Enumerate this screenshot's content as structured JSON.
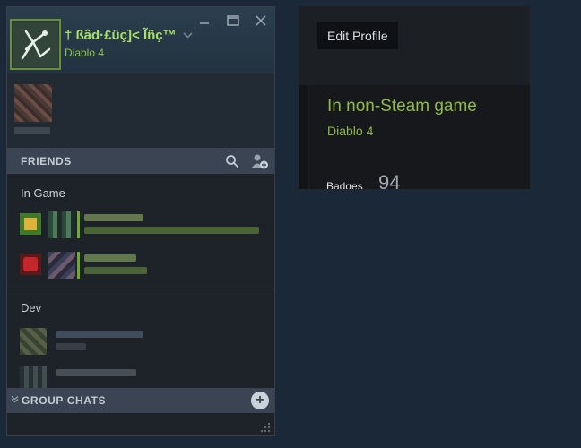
{
  "user": {
    "name": "† ßâd·£üç]< Ĩñç™",
    "status_game": "Diablo 4"
  },
  "friends_section": {
    "title": "FRIENDS"
  },
  "groups": [
    {
      "label": "In Game"
    },
    {
      "label": "Dev"
    }
  ],
  "group_chats": {
    "title": "GROUP CHATS",
    "add_symbol": "+"
  },
  "profile": {
    "edit_button": "Edit Profile",
    "status_text": "In non-Steam game",
    "status_game": "Diablo 4",
    "badges_label": "Badges",
    "badges_count": "94"
  },
  "colors": {
    "in_game_green": "#8fb94a",
    "panel_bg": "#1e2329",
    "header_bar": "#3a4452",
    "page_bg": "#1b2838"
  },
  "icons": {
    "avatar": "tree-rune-avatar",
    "minimize": "minimize-icon",
    "maximize": "maximize-icon",
    "close": "close-icon",
    "search": "search-icon",
    "add_friend": "add-friend-icon"
  }
}
